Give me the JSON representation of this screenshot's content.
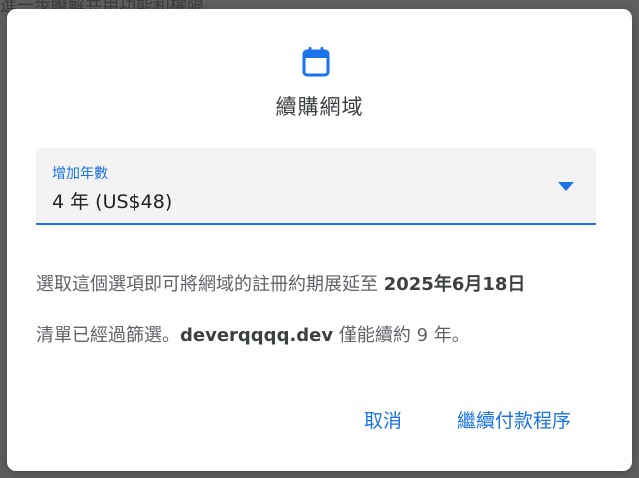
{
  "backdrop": {
    "text": "進一步瞭解共用功能和權限"
  },
  "dialog": {
    "icon": "calendar-icon",
    "title": "續購網域",
    "select": {
      "label": "增加年數",
      "value": "4 年 (US$48)"
    },
    "description1": {
      "prefix": "選取這個選項即可將網域的註冊約期展延至 ",
      "date": "2025年6月18日"
    },
    "description2": {
      "prefix": "清單已經過篩選。",
      "domain": "deverqqqq.dev",
      "suffix": " 僅能續約 9 年。"
    },
    "buttons": {
      "cancel": "取消",
      "continue": "繼續付款程序"
    }
  },
  "colors": {
    "accent": "#1a73e8",
    "text_primary": "#202124",
    "text_secondary": "#5f6368",
    "field_bg": "#f3f3f3",
    "overlay": "#5f5f5f"
  }
}
